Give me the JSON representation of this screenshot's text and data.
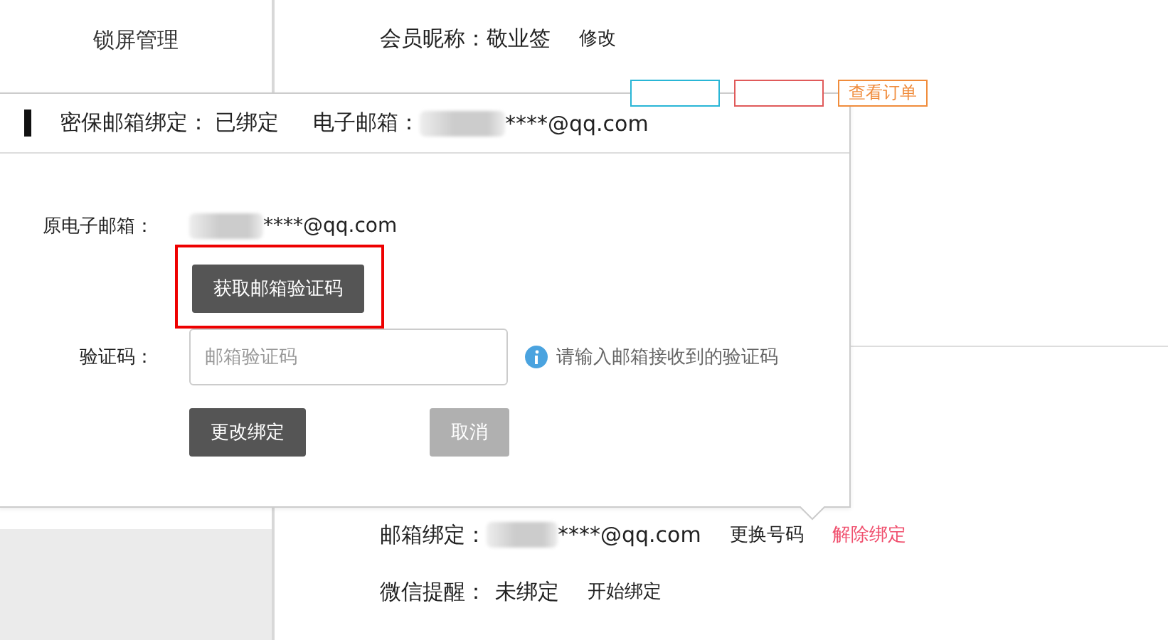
{
  "sidebar": {
    "items": [
      {
        "label": "锁屏管理",
        "selected": false
      }
    ]
  },
  "profile": {
    "nickname_label": "会员昵称：",
    "nickname": "敬业签",
    "edit_link": "修改",
    "level_buttons": [
      {
        "color": "#29b6d6"
      },
      {
        "color": "#e05a5a"
      },
      {
        "label": "查看订单",
        "color": "#f08c3c"
      }
    ],
    "email_label": "邮箱绑定：",
    "email": "****@qq.com",
    "email_change": "更换号码",
    "email_unbind": "解除绑定",
    "wechat_label": "微信提醒：",
    "wechat": "未绑定",
    "wechat_bind": "开始绑定"
  },
  "popup": {
    "title": "密保邮箱绑定：",
    "status": "已绑定",
    "email_label": "电子邮箱：",
    "email": "****@qq.com",
    "old_email_label": "原电子邮箱：",
    "old_email": "****@qq.com",
    "get_code_button": "获取邮箱验证码",
    "get_code_highlighted": true,
    "code_label": "验证码：",
    "code_placeholder": "邮箱验证码",
    "code_hint": "请输入邮箱接收到的验证码",
    "buttons": [
      {
        "label": "更改绑定",
        "disabled": false
      },
      {
        "label": "取消",
        "disabled": true
      }
    ]
  }
}
